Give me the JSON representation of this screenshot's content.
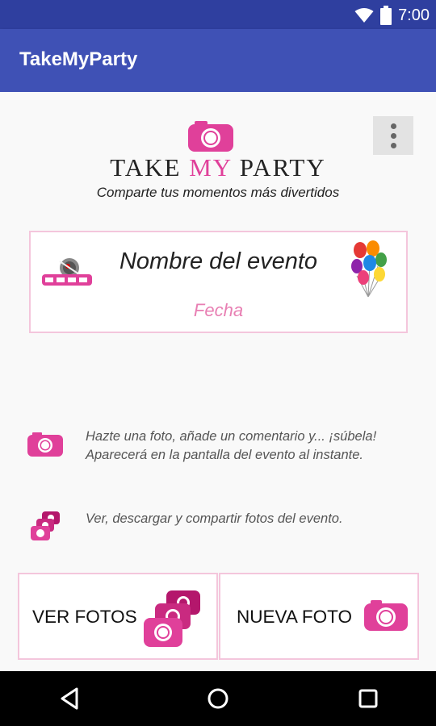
{
  "status_bar": {
    "time": "7:00",
    "icons": [
      "wifi-icon",
      "battery-icon"
    ]
  },
  "app_bar": {
    "title": "TakeMyParty"
  },
  "header": {
    "logo_words": {
      "take": "TAKE ",
      "my": "MY",
      "party": " PARTY"
    },
    "tagline": "Comparte tus momentos más divertidos",
    "overflow_icon": "more-vert-icon"
  },
  "event": {
    "name": "Nombre del evento",
    "date": "Fecha"
  },
  "info": [
    {
      "icon": "camera-icon",
      "text": "Hazte una foto, añade un comentario y... ¡súbela! Aparecerá en la pantalla del evento al instante."
    },
    {
      "icon": "stacked-cameras-icon",
      "text": "Ver, descargar y compartir fotos del evento."
    }
  ],
  "actions": {
    "view_photos": "VER FOTOS",
    "new_photo": "NUEVA FOTO"
  },
  "nav": {
    "icons": [
      "back-icon",
      "home-icon",
      "recents-icon"
    ]
  },
  "colors": {
    "primary": "#3f51b5",
    "primary_dark": "#2f3f9f",
    "accent": "#e0409a",
    "card_border": "#f4c6dc",
    "date_pink": "#e87fb3"
  }
}
